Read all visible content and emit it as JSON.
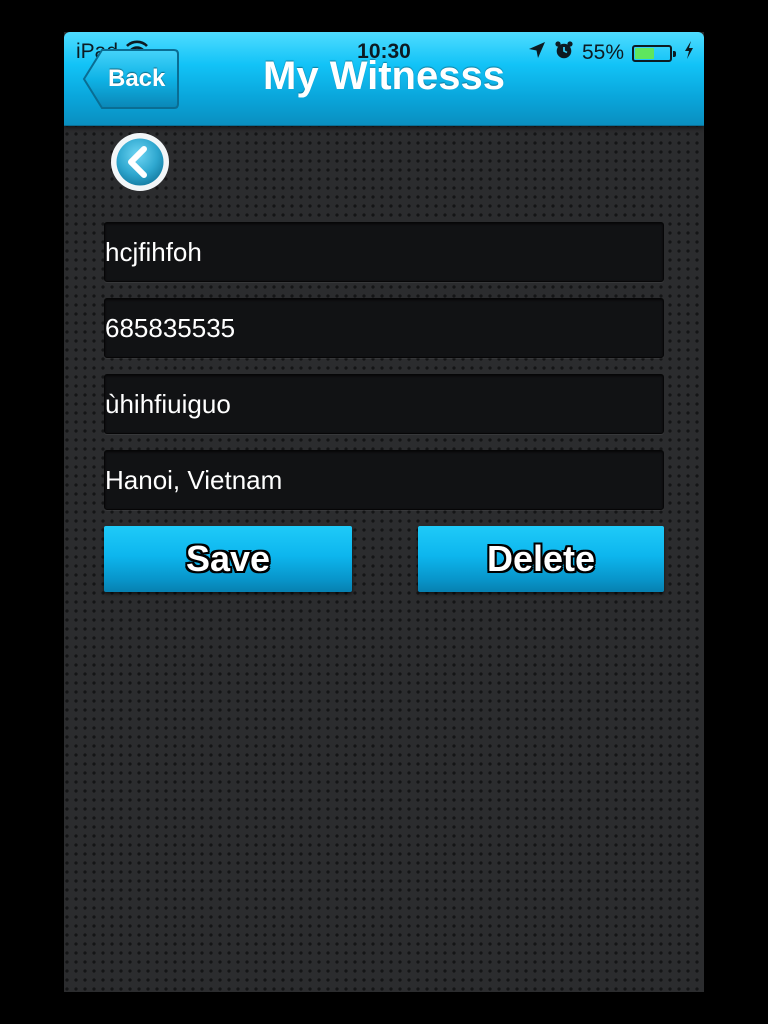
{
  "status_bar": {
    "device": "iPad",
    "time": "10:30",
    "battery_text": "55%",
    "battery_level": 0.55,
    "icons": [
      "wifi-icon",
      "location-arrow-icon",
      "alarm-clock-icon",
      "battery-icon",
      "charging-bolt-icon"
    ]
  },
  "navbar": {
    "back_label": "Back",
    "title": "My Witnesss"
  },
  "form": {
    "fields": [
      {
        "value": "hcjfihfoh"
      },
      {
        "value": "685835535"
      },
      {
        "value": "ùhihfiuiguo"
      },
      {
        "value": "Hanoi, Vietnam"
      }
    ]
  },
  "actions": {
    "save_label": "Save",
    "delete_label": "Delete"
  },
  "colors": {
    "accent": "#0db6ee",
    "background": "#2b2c2e",
    "field_background": "#111214"
  }
}
